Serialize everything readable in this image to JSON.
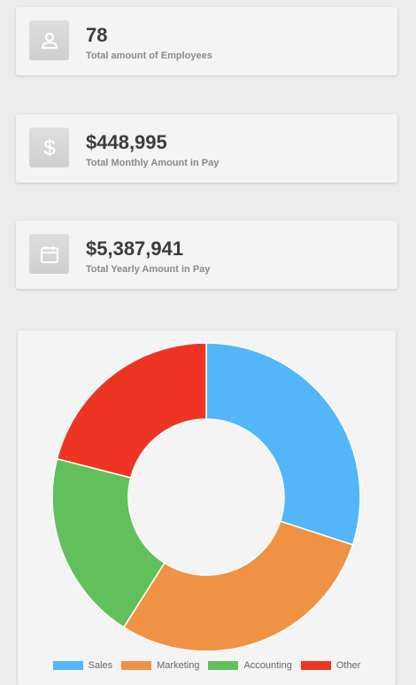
{
  "stats": [
    {
      "value": "78",
      "label": "Total amount of Employees",
      "icon": "person-icon"
    },
    {
      "value": "$448,995",
      "label": "Total Monthly Amount in Pay",
      "icon": "dollar-icon"
    },
    {
      "value": "$5,387,941",
      "label": "Total Yearly Amount in Pay",
      "icon": "calendar-icon"
    }
  ],
  "chart_data": {
    "type": "pie",
    "donut": true,
    "categories": [
      "Sales",
      "Marketing",
      "Accounting",
      "Other"
    ],
    "values": [
      30,
      29,
      20,
      21
    ],
    "colors": [
      "#52b6f9",
      "#f09244",
      "#62c05c",
      "#ee3524"
    ],
    "legend_position": "bottom"
  }
}
